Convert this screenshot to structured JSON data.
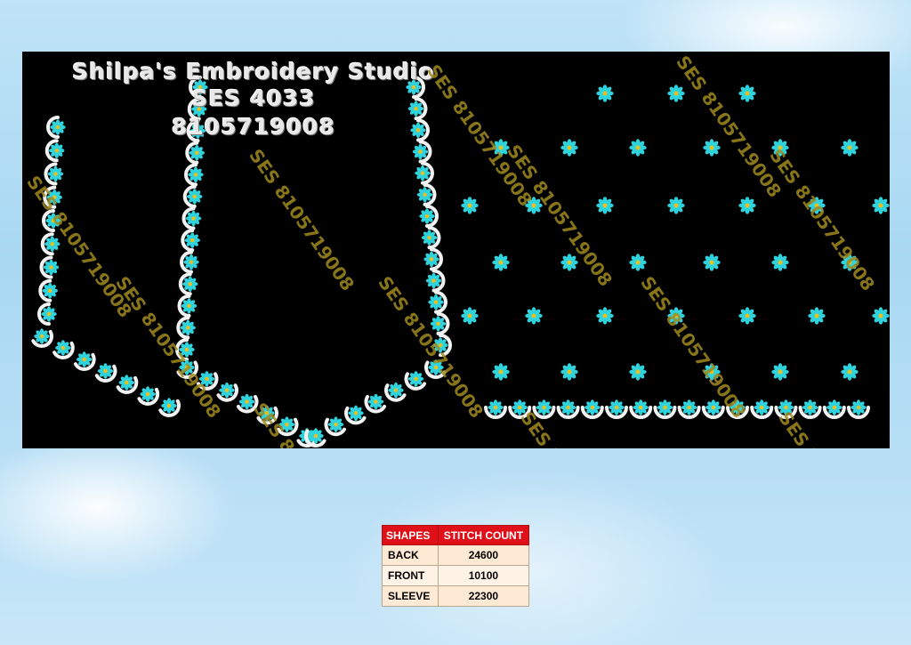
{
  "header": {
    "studio_name": "Shilpa's Embroidery Studio",
    "design_code": "SES  4033",
    "phone": "8105719008"
  },
  "watermark_text": "SES 8105719008",
  "colors": {
    "flower_petal": "#2fd3de",
    "flower_center": "#e6c020",
    "scallop": "#f2f2f2",
    "watermark": "#a08a1e",
    "table_header": "#e01018"
  },
  "stitch_table": {
    "headers": [
      "SHAPES",
      "STITCH COUNT"
    ],
    "rows": [
      {
        "shape": "BACK",
        "count": "24600"
      },
      {
        "shape": "FRONT",
        "count": "10100"
      },
      {
        "shape": "SLEEVE",
        "count": "22300"
      }
    ]
  }
}
